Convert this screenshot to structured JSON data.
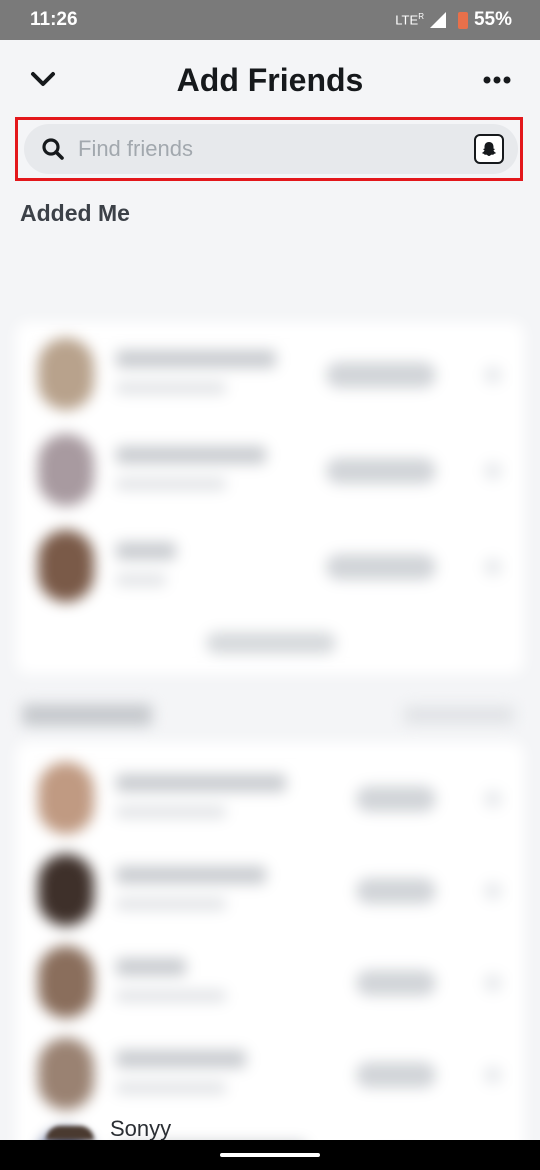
{
  "status_bar": {
    "time": "11:26",
    "network": "LTE",
    "roaming": "R",
    "battery_percent": "55%"
  },
  "header": {
    "title": "Add Friends",
    "back_icon": "chevron-down-icon",
    "more_icon": "more-dots-icon"
  },
  "search": {
    "placeholder": "Find friends",
    "value": "",
    "highlight_color": "#e3171b"
  },
  "sections": {
    "added_me_title": "Added Me"
  },
  "peek_item": {
    "name": "Sonyy"
  }
}
